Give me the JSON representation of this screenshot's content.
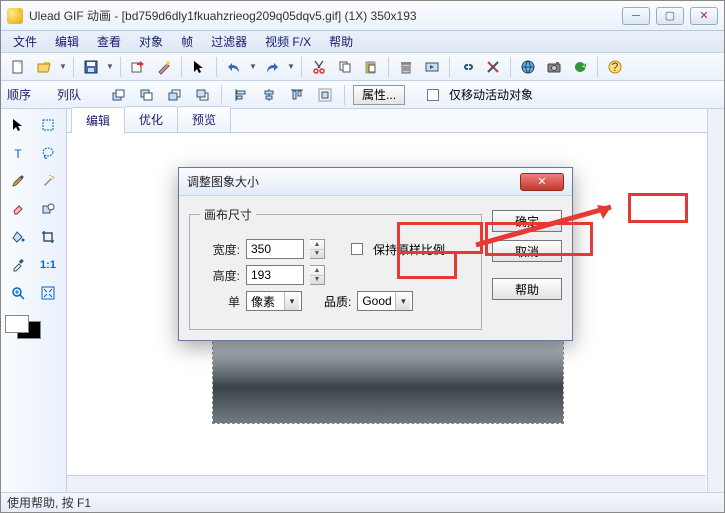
{
  "title": "Ulead GIF 动画 - [bd759d6dly1fkuahzrieog209q05dqv5.gif] (1X) 350x193",
  "menu": [
    "文件",
    "编辑",
    "查看",
    "对象",
    "帧",
    "过滤器",
    "视频 F/X",
    "帮助"
  ],
  "toolbar2": {
    "order": "顺序",
    "queue": "列队",
    "props": "属性...",
    "onlymove": "仅移动活动对象"
  },
  "tabs": [
    "编辑",
    "优化",
    "预览"
  ],
  "dialog": {
    "title": "调整图象大小",
    "legend": "画布尺寸",
    "width_label": "宽度:",
    "width": "350",
    "height_label": "高度:",
    "height": "193",
    "keep_ratio": "保持原样比例",
    "unit_label": "单",
    "unit": "像素",
    "quality_label": "品质:",
    "quality": "Good",
    "ok": "确定",
    "cancel": "取消",
    "help": "帮助"
  },
  "status": "使用帮助, 按 F1"
}
